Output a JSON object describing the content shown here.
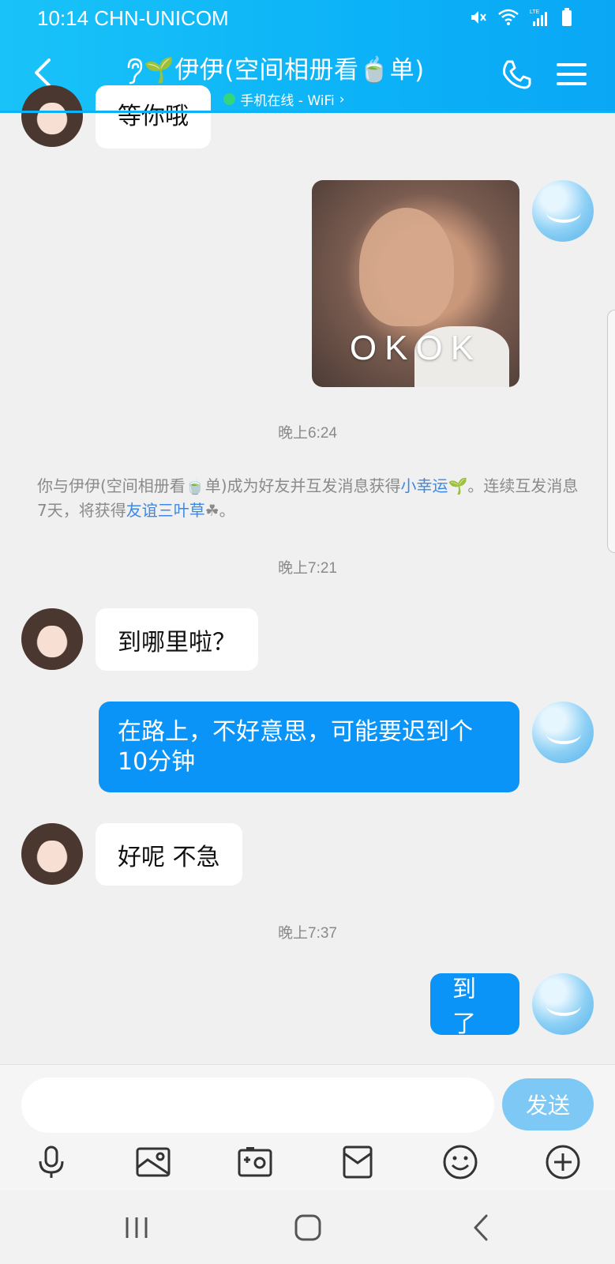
{
  "status_bar": {
    "time_carrier": "10:14 CHN-UNICOM",
    "lte": "LTE"
  },
  "header": {
    "title": "🌱伊伊(空间相册看🍵单)",
    "subtitle": "手机在线 - WiFi",
    "subtitle_chevron": "›",
    "accent": "#0cb2f7"
  },
  "messages": {
    "top_partial": "等你哦",
    "sticker_text": "OKOK",
    "time1": "晚上6:24",
    "system_prefix": "你与伊伊(空间相册看🍵单)成为好友并互发消息获得",
    "system_link1": "小幸运",
    "system_mid": "🌱。连续互发消息7天，将获得",
    "system_link2": "友谊三叶草",
    "system_suffix": "☘。",
    "time2": "晚上7:21",
    "msg1": "到哪里啦？",
    "msg2": "在路上，不好意思，可能要迟到个10分钟",
    "msg3": "好呢 不急",
    "time3": "晚上7:37",
    "msg4": "到了"
  },
  "input": {
    "placeholder": "",
    "send_label": "发送"
  },
  "tools": [
    "mic-icon",
    "image-icon",
    "camera-icon",
    "envelope-icon",
    "emoji-icon",
    "plus-icon"
  ],
  "colors": {
    "outgoing_bubble": "#0a94f8",
    "incoming_bubble": "#ffffff",
    "background": "#f0f0f0",
    "link": "#3d88e6"
  }
}
